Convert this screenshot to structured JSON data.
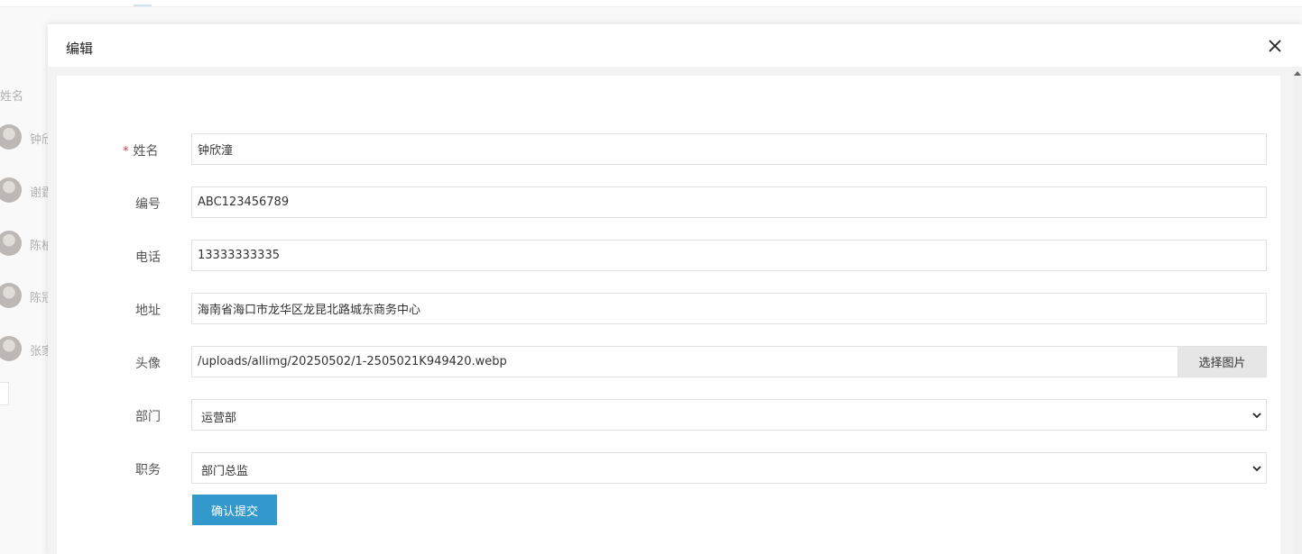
{
  "background": {
    "column_header": "姓名",
    "rows": [
      {
        "name": "钟欣"
      },
      {
        "name": "谢霆"
      },
      {
        "name": "陈柏"
      },
      {
        "name": "陈冠"
      },
      {
        "name": "张家"
      }
    ]
  },
  "modal": {
    "title": "编辑",
    "close_icon": "close-icon",
    "form": {
      "name": {
        "label": "姓名",
        "required_mark": "*",
        "value": "钟欣潼"
      },
      "number": {
        "label": "编号",
        "value": "ABC123456789"
      },
      "phone": {
        "label": "电话",
        "value": "13333333335"
      },
      "address": {
        "label": "地址",
        "value": "海南省海口市龙华区龙昆北路城东商务中心"
      },
      "avatar": {
        "label": "头像",
        "value": "/uploads/allimg/20250502/1-2505021K949420.webp",
        "button_label": "选择图片"
      },
      "department": {
        "label": "部门",
        "selected": "运营部"
      },
      "position": {
        "label": "职务",
        "selected": "部门总监"
      },
      "submit_label": "确认提交"
    }
  },
  "colors": {
    "primary_button": "#3399cc",
    "required_mark": "#e4393c"
  }
}
